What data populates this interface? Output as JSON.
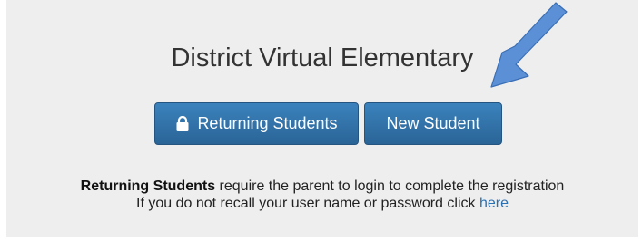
{
  "header": {
    "title": "District Virtual Elementary"
  },
  "buttons": {
    "returning_label": "Returning Students",
    "new_label": "New Student"
  },
  "info": {
    "line1_bold": "Returning Students",
    "line1_rest": " require the parent to login to complete the registration",
    "line2_text": "If you do not recall your user name or password click ",
    "line2_link": "here"
  },
  "icons": {
    "returning_button_icon": "lock-icon",
    "annotation": "arrow-icon"
  },
  "colors": {
    "button": "#2a6496",
    "link": "#2a6fb0",
    "panel": "#eeeeee",
    "arrow": "#5b8fd6"
  }
}
